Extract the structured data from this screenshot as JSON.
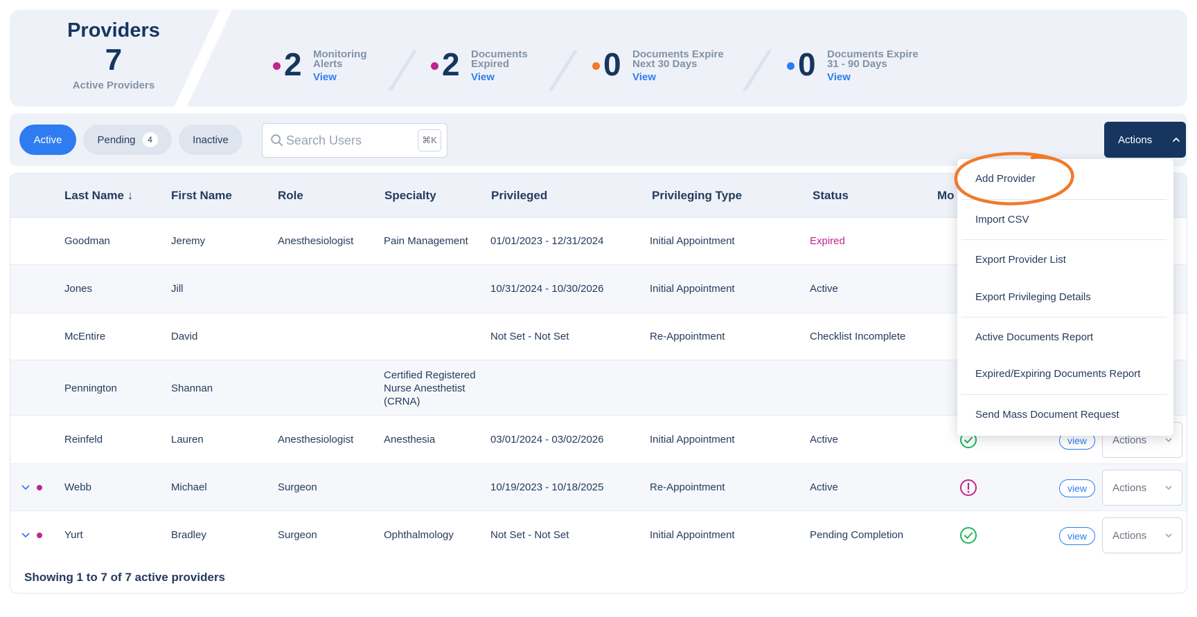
{
  "summary": {
    "title": "Providers",
    "count": "7",
    "subtitle": "Active Providers",
    "stats": [
      {
        "value": "2",
        "label": "Monitoring\nAlerts",
        "link": "View",
        "color": "#c0258c"
      },
      {
        "value": "2",
        "label": "Documents\nExpired",
        "link": "View",
        "color": "#c0258c"
      },
      {
        "value": "0",
        "label": "Documents Expire\nNext 30 Days",
        "link": "View",
        "color": "#f07a2a"
      },
      {
        "value": "0",
        "label": "Documents Expire\n31 - 90 Days",
        "link": "View",
        "color": "#2f7cf0"
      }
    ]
  },
  "filters": {
    "tabs": [
      {
        "label": "Active"
      },
      {
        "label": "Pending",
        "badge": "4"
      },
      {
        "label": "Inactive"
      }
    ],
    "search_placeholder": "Search Users",
    "search_shortcut": "⌘K",
    "actions_label": "Actions"
  },
  "table": {
    "headers": [
      "Last Name ↓",
      "First Name",
      "Role",
      "Specialty",
      "Privileged",
      "Privileging Type",
      "Status",
      "Mo"
    ],
    "rows": [
      {
        "last": "Goodman",
        "first": "Jeremy",
        "role": "Anesthesiologist",
        "specialty": "Pain Management",
        "privileged": "01/01/2023 - 12/31/2024",
        "type": "Initial Appointment",
        "status": "Expired"
      },
      {
        "last": "Jones",
        "first": "Jill",
        "role": "",
        "specialty": "",
        "privileged": "10/31/2024 - 10/30/2026",
        "type": "Initial Appointment",
        "status": "Active"
      },
      {
        "last": "McEntire",
        "first": "David",
        "role": "",
        "specialty": "",
        "privileged": "Not Set - Not Set",
        "type": "Re-Appointment",
        "status": "Checklist Incomplete"
      },
      {
        "last": "Pennington",
        "first": "Shannan",
        "role": "",
        "specialty": "Certified Registered\nNurse Anesthetist\n(CRNA)",
        "privileged": "",
        "type": "",
        "status": ""
      },
      {
        "last": "Reinfeld",
        "first": "Lauren",
        "role": "Anesthesiologist",
        "specialty": "Anesthesia",
        "privileged": "03/01/2024 - 03/02/2026",
        "type": "Initial Appointment",
        "status": "Active",
        "monitor": "check-circle-icon",
        "view": "view",
        "actions": "Actions"
      },
      {
        "last": "Webb",
        "first": "Michael",
        "role": "Surgeon",
        "specialty": "",
        "privileged": "10/19/2023 - 10/18/2025",
        "type": "Re-Appointment",
        "status": "Active",
        "monitor": "alert-circle-icon",
        "view": "view",
        "actions": "Actions"
      },
      {
        "last": "Yurt",
        "first": "Bradley",
        "role": "Surgeon",
        "specialty": "Ophthalmology",
        "privileged": "Not Set - Not Set",
        "type": "Initial Appointment",
        "status": "Pending Completion",
        "monitor": "check-circle-icon",
        "view": "view",
        "actions": "Actions"
      }
    ],
    "footer": "Showing 1 to 7 of 7 active providers"
  },
  "actions_menu": {
    "items": [
      "Add Provider",
      "Import CSV",
      "Export Provider List",
      "Export Privileging Details",
      "Active Documents Report",
      "Expired/Expiring Documents Report",
      "Send Mass Document Request"
    ]
  },
  "colors": {
    "accent": "#2f7cf0",
    "navy": "#16365f",
    "expired": "#c0258c",
    "success": "#22b35a",
    "highlight": "#f07a2a"
  }
}
